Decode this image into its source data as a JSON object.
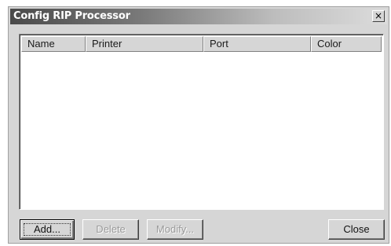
{
  "window": {
    "title": "Config RIP Processor",
    "close_glyph": "×",
    "close_icon": "close-icon"
  },
  "list": {
    "columns": [
      "Name",
      "Printer",
      "Port",
      "Color"
    ],
    "rows": []
  },
  "buttons": {
    "add": "Add...",
    "delete": "Delete",
    "modify": "Modify...",
    "close": "Close"
  }
}
